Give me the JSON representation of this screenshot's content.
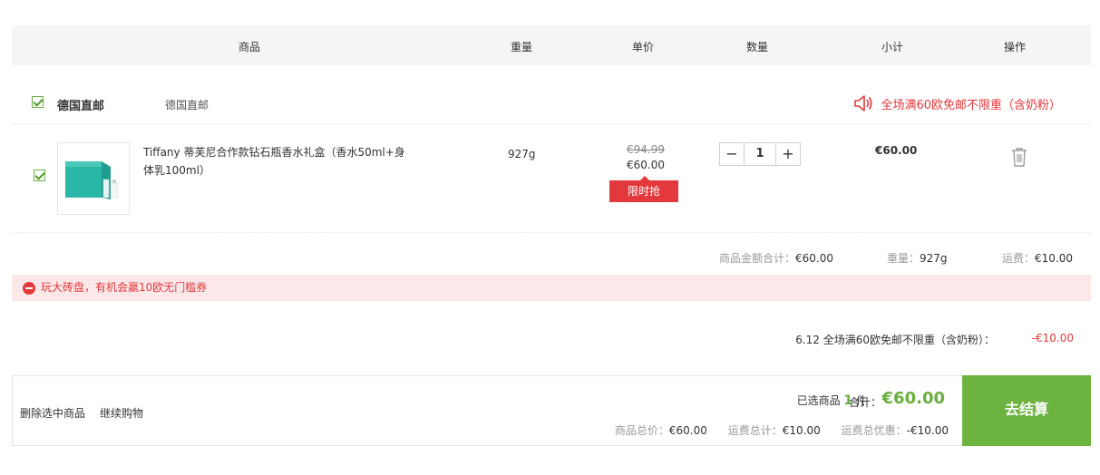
{
  "header": {
    "col_product": "商品",
    "col_weight": "重量",
    "col_unit_price": "单价",
    "col_quantity": "数量",
    "col_subtotal": "小计",
    "col_action": "操作"
  },
  "store": {
    "name": "德国直邮",
    "subtitle": "德国直邮",
    "promo_text": "全场满60欧免邮不限重（含奶粉）"
  },
  "item": {
    "title": "Tiffany 蒂芙尼合作款钻石瓶香水礼盒（香水50ml+身体乳100ml）",
    "weight": "927g",
    "original_price": "€94.99",
    "price": "€60.00",
    "badge": "限时抢",
    "quantity": "1",
    "minus_label": "−",
    "plus_label": "+",
    "subtotal": "€60.00"
  },
  "summary": {
    "amount_label": "商品金额合计：",
    "amount_value": "€60.00",
    "weight_label": "重量：",
    "weight_value": "927g",
    "shipping_label": "运费：",
    "shipping_value": "€10.00"
  },
  "notice": {
    "text": "玩大砖盘，有机会赢10欧无门槛券"
  },
  "discount": {
    "label": "6.12 全场满60欧免邮不限重（含奶粉）：",
    "value": "-€10.00"
  },
  "footer": {
    "delete_selected": "删除选中商品",
    "continue_shopping": "继续购物",
    "selected_prefix": "已选商品",
    "selected_count": "1",
    "selected_suffix": "件",
    "total_label": "合计：",
    "total_value": "€60.00",
    "goods_total_label": "商品总价：",
    "goods_total_value": "€60.00",
    "shipping_total_label": "运费总计：",
    "shipping_total_value": "€10.00",
    "shipping_discount_label": "运费总优惠：",
    "shipping_discount_value": "-€10.00",
    "checkout_label": "去结算"
  },
  "colors": {
    "accent_green": "#6db33f",
    "alert_red": "#e4393c",
    "notice_bg": "#fde8e9"
  }
}
